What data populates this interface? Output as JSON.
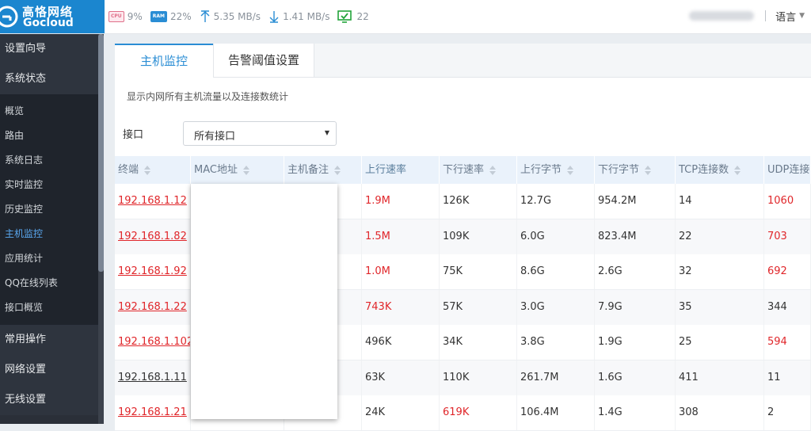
{
  "brand": {
    "name_cn": "高恪网络",
    "name_en": "Gocloud"
  },
  "status": {
    "cpu_chip": "CPU",
    "cpu": "9%",
    "ram_chip": "RAM",
    "ram": "22%",
    "upload": "5.35 MB/s",
    "download": "1.41 MB/s",
    "online": "22",
    "language": "语言"
  },
  "nav": {
    "setup_wizard": "设置向导",
    "system_status": "系统状态",
    "sub": [
      "概览",
      "路由",
      "系统日志",
      "实时监控",
      "历史监控",
      "主机监控",
      "应用统计",
      "QQ在线列表",
      "接口概览"
    ],
    "common_ops": "常用操作",
    "network": "网络设置",
    "wireless": "无线设置"
  },
  "tabs": {
    "host_monitor": "主机监控",
    "alarm_threshold": "告警阈值设置"
  },
  "page": {
    "description": "显示内网所有主机流量以及连接数统计",
    "filter_label": "接口",
    "filter_value": "所有接口"
  },
  "table": {
    "headers": [
      "终端",
      "MAC地址",
      "主机备注",
      "上行速率",
      "下行速率",
      "上行字节",
      "下行字节",
      "TCP连接数",
      "UDP连接"
    ],
    "rows": [
      {
        "ip": "192.168.1.12",
        "up_rate": "1.9M",
        "down_rate": "126K",
        "up_bytes": "12.7G",
        "down_bytes": "954.2M",
        "tcp": "14",
        "udp": "1060"
      },
      {
        "ip": "192.168.1.82",
        "up_rate": "1.5M",
        "down_rate": "109K",
        "up_bytes": "6.0G",
        "down_bytes": "823.4M",
        "tcp": "22",
        "udp": "703"
      },
      {
        "ip": "192.168.1.92",
        "up_rate": "1.0M",
        "down_rate": "75K",
        "up_bytes": "8.6G",
        "down_bytes": "2.6G",
        "tcp": "32",
        "udp": "692"
      },
      {
        "ip": "192.168.1.22",
        "up_rate": "743K",
        "down_rate": "57K",
        "up_bytes": "3.0G",
        "down_bytes": "7.9G",
        "tcp": "35",
        "udp": "344"
      },
      {
        "ip": "192.168.1.102",
        "up_rate": "496K",
        "down_rate": "34K",
        "up_bytes": "3.8G",
        "down_bytes": "1.9G",
        "tcp": "25",
        "udp": "594"
      },
      {
        "ip": "192.168.1.11",
        "up_rate": "63K",
        "down_rate": "110K",
        "up_bytes": "261.7M",
        "down_bytes": "1.6G",
        "tcp": "411",
        "udp": "11"
      },
      {
        "ip": "192.168.1.21",
        "up_rate": "24K",
        "down_rate": "619K",
        "up_bytes": "106.4M",
        "down_bytes": "1.4G",
        "tcp": "308",
        "udp": "2"
      }
    ]
  },
  "colors": {
    "brand_blue": "#1b86cf",
    "accent": "#2a8dd4",
    "alert_red": "#e0262a",
    "sidebar": "#2a2f38"
  }
}
